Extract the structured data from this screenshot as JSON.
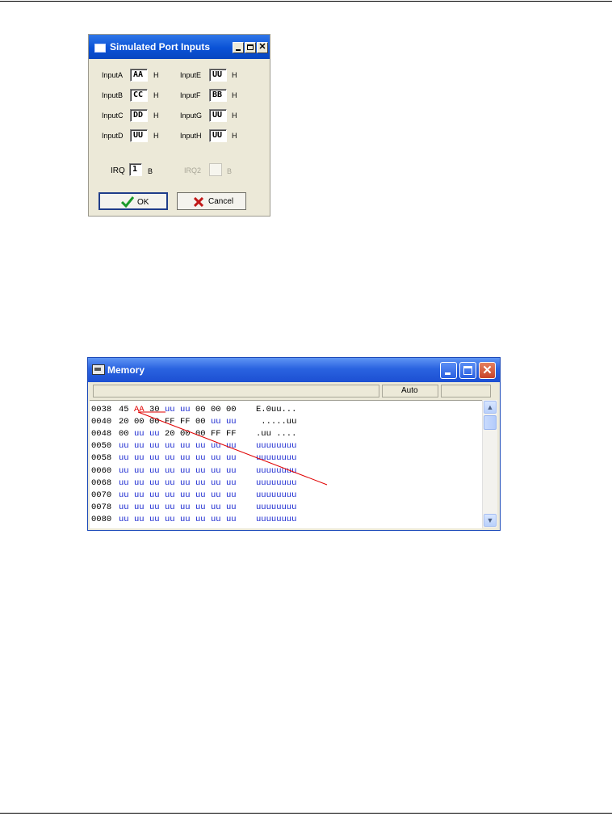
{
  "port_dialog": {
    "title": "Simulated Port Inputs",
    "inputs_left": [
      {
        "label": "InputA",
        "value": "AA",
        "suffix": "H"
      },
      {
        "label": "InputB",
        "value": "CC",
        "suffix": "H"
      },
      {
        "label": "InputC",
        "value": "DD",
        "suffix": "H"
      },
      {
        "label": "InputD",
        "value": "UU",
        "suffix": "H"
      }
    ],
    "inputs_right": [
      {
        "label": "InputE",
        "value": "UU",
        "suffix": "H"
      },
      {
        "label": "InputF",
        "value": "BB",
        "suffix": "H"
      },
      {
        "label": "InputG",
        "value": "UU",
        "suffix": "H"
      },
      {
        "label": "InputH",
        "value": "UU",
        "suffix": "H"
      }
    ],
    "irq": {
      "label": "IRQ",
      "value": "1",
      "suffix": "B"
    },
    "irq2": {
      "label": "IRQ2",
      "value": "",
      "suffix": "B"
    },
    "ok_label": "OK",
    "cancel_label": "Cancel",
    "colors": {
      "title_bar": "#0a52d6",
      "ok_check": "#1a9a2a",
      "cancel_x": "#c01818"
    }
  },
  "memory_window": {
    "title": "Memory",
    "status_mode": "Auto",
    "rows": [
      {
        "addr": "0038",
        "bytes": [
          "45",
          "AA",
          "30",
          "uu",
          "uu",
          "00",
          "00",
          "00"
        ],
        "ascii": "E.0uu..."
      },
      {
        "addr": "0040",
        "bytes": [
          "20",
          "00",
          "00",
          "FF",
          "FF",
          "00",
          "uu",
          "uu"
        ],
        "ascii": " .....uu"
      },
      {
        "addr": "0048",
        "bytes": [
          "00",
          "uu",
          "uu",
          "20",
          "00",
          "00",
          "FF",
          "FF"
        ],
        "ascii": ".uu ...."
      },
      {
        "addr": "0050",
        "bytes": [
          "uu",
          "uu",
          "uu",
          "uu",
          "uu",
          "uu",
          "uu",
          "uu"
        ],
        "ascii": "uuuuuuuu"
      },
      {
        "addr": "0058",
        "bytes": [
          "uu",
          "uu",
          "uu",
          "uu",
          "uu",
          "uu",
          "uu",
          "uu"
        ],
        "ascii": "uuuuuuuu"
      },
      {
        "addr": "0060",
        "bytes": [
          "uu",
          "uu",
          "uu",
          "uu",
          "uu",
          "uu",
          "uu",
          "uu"
        ],
        "ascii": "uuuuuuuu"
      },
      {
        "addr": "0068",
        "bytes": [
          "uu",
          "uu",
          "uu",
          "uu",
          "uu",
          "uu",
          "uu",
          "uu"
        ],
        "ascii": "uuuuuuuu"
      },
      {
        "addr": "0070",
        "bytes": [
          "uu",
          "uu",
          "uu",
          "uu",
          "uu",
          "uu",
          "uu",
          "uu"
        ],
        "ascii": "uuuuuuuu"
      },
      {
        "addr": "0078",
        "bytes": [
          "uu",
          "uu",
          "uu",
          "uu",
          "uu",
          "uu",
          "uu",
          "uu"
        ],
        "ascii": "uuuuuuuu"
      },
      {
        "addr": "0080",
        "bytes": [
          "uu",
          "uu",
          "uu",
          "uu",
          "uu",
          "uu",
          "uu",
          "uu"
        ],
        "ascii": "uuuuuuuu"
      }
    ],
    "highlighted_byte": {
      "row": 0,
      "index": 1
    },
    "colors": {
      "undefined_text": "#1a28d0",
      "highlight_text": "#e00000",
      "annotation_arrow": "#e00000"
    }
  }
}
